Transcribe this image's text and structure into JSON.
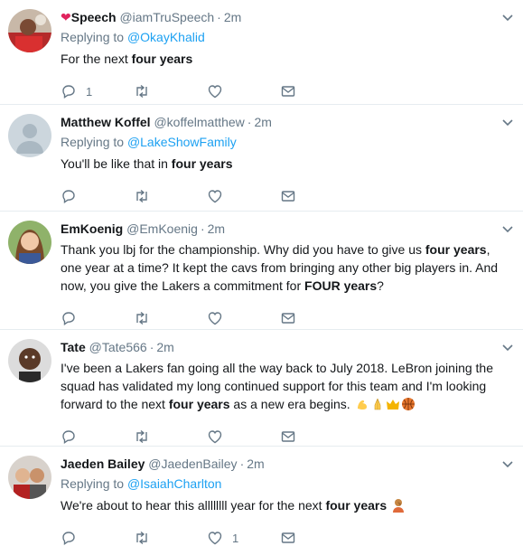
{
  "tweets": [
    {
      "name": "Speech",
      "handle": "@iamTruSpeech",
      "time": "2m",
      "reply_prefix": "Replying to",
      "reply_to": "@OkayKhalid",
      "text": [
        {
          "t": "For the next "
        },
        {
          "t": "four years",
          "b": true
        }
      ],
      "reply_count": "1",
      "like_count": "",
      "icons": {
        "reply": "reply-icon",
        "retweet": "retweet-icon",
        "like": "heart-icon",
        "dm": "mail-icon"
      }
    },
    {
      "name": "Matthew Koffel",
      "handle": "@koffelmatthew",
      "time": "2m",
      "reply_prefix": "Replying to",
      "reply_to": "@LakeShowFamily",
      "text": [
        {
          "t": "You'll be like that in "
        },
        {
          "t": "four years",
          "b": true
        }
      ],
      "reply_count": "",
      "like_count": ""
    },
    {
      "name": "EmKoenig",
      "handle": "@EmKoenig",
      "time": "2m",
      "reply_prefix": "",
      "reply_to": "",
      "text": [
        {
          "t": "Thank you lbj for the championship. Why did you have to give us "
        },
        {
          "t": "four years",
          "b": true
        },
        {
          "t": ", one year at a time? It kept the cavs from bringing any other big players in. And now, you give the Lakers a commitment for "
        },
        {
          "t": "FOUR years",
          "b": true
        },
        {
          "t": "?"
        }
      ],
      "reply_count": "",
      "like_count": ""
    },
    {
      "name": "Tate",
      "handle": "@Tate566",
      "time": "2m",
      "reply_prefix": "",
      "reply_to": "",
      "text": [
        {
          "t": "I've been a Lakers fan going all the way back to July 2018. LeBron joining the squad has validated my long continued support for this team and I'm looking forward to the next "
        },
        {
          "t": "four years",
          "b": true
        },
        {
          "t": " as a new era begins. "
        }
      ],
      "emojis": [
        "flexed-biceps-emoji",
        "folded-hands-emoji",
        "crown-emoji",
        "basketball-emoji"
      ],
      "reply_count": "",
      "like_count": ""
    },
    {
      "name": "Jaeden Bailey",
      "handle": "@JaedenBailey",
      "time": "2m",
      "reply_prefix": "Replying to",
      "reply_to": "@IsaiahCharlton",
      "text": [
        {
          "t": "We're about to hear this allllllll year for the next "
        },
        {
          "t": "four years",
          "b": true
        },
        {
          "t": " "
        }
      ],
      "emojis": [
        "facepalm-emoji"
      ],
      "reply_count": "",
      "like_count": "1"
    }
  ],
  "colors": {
    "accent": "#1da1f2",
    "text": "#14171a",
    "muted": "#657786",
    "divider": "#e6ecf0"
  }
}
